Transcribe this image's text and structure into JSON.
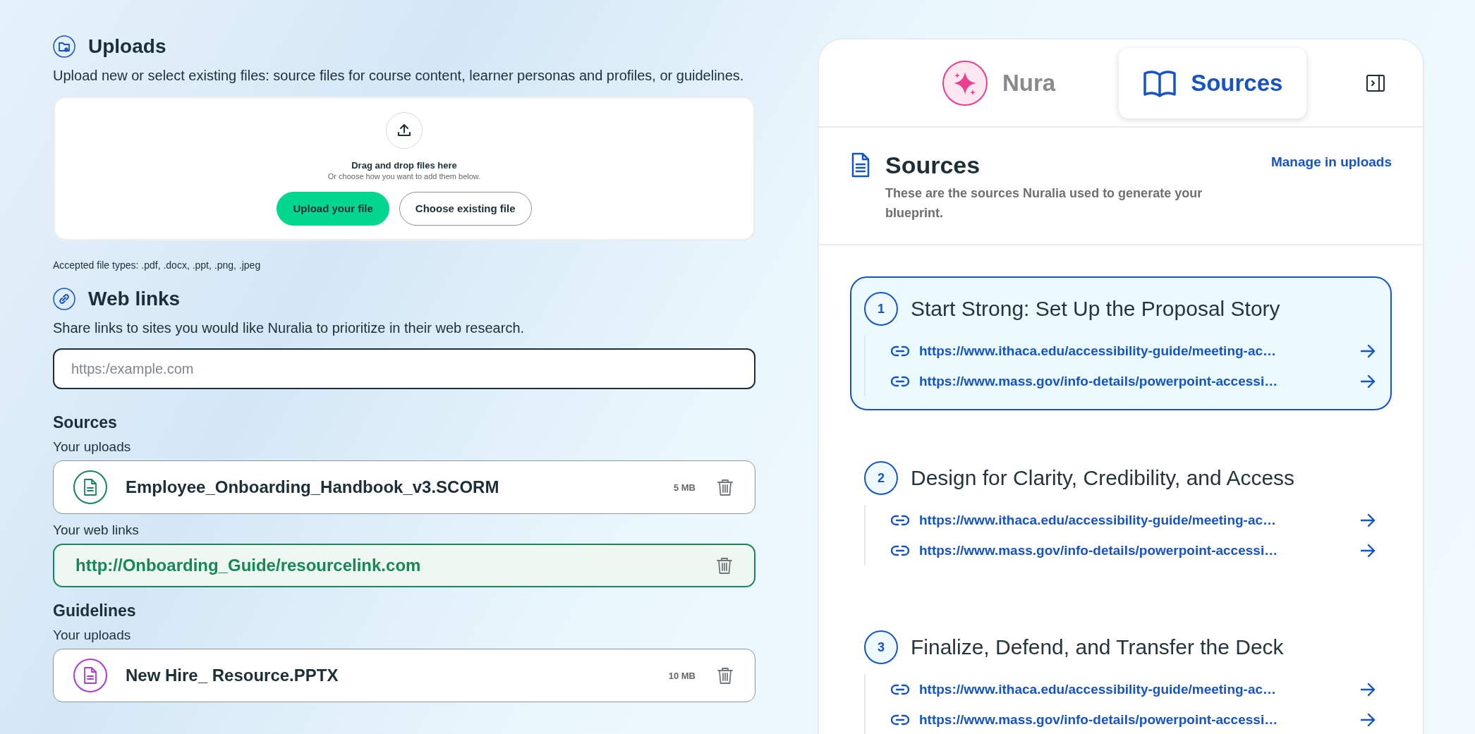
{
  "uploads": {
    "title": "Uploads",
    "description": "Upload new or select existing files: source files for course content, learner personas and profiles, or guidelines.",
    "dropzone": {
      "title": "Drag and drop files here",
      "subtitle": "Or choose how you want to add them below.",
      "buttons": [
        {
          "label": "Upload your file",
          "kind": "primary"
        },
        {
          "label": "Choose existing file",
          "kind": "secondary"
        }
      ]
    },
    "accepted": "Accepted file types: .pdf, .docx, .ppt, .png, .jpeg"
  },
  "web_links": {
    "title": "Web links",
    "description": "Share links to sites you would like Nuralia to prioritize in their web research.",
    "input": {
      "placeholder": "https:/example.com"
    }
  },
  "groups": [
    {
      "title": "Sources",
      "lists": [
        {
          "label": "Your uploads",
          "items": [
            {
              "kind": "file",
              "name": "Employee_Onboarding_Handbook_v3.SCORM",
              "size": "5 MB",
              "color": "#17865a"
            }
          ]
        },
        {
          "label": "Your web links",
          "items": [
            {
              "kind": "link",
              "name": "http://Onboarding_Guide/resourcelink.com"
            }
          ]
        }
      ]
    },
    {
      "title": "Guidelines",
      "lists": [
        {
          "label": "Your uploads",
          "items": [
            {
              "kind": "file",
              "name": "New Hire_ Resource.PPTX",
              "size": "10 MB",
              "color": "#b03ad4"
            }
          ]
        }
      ]
    }
  ],
  "panel": {
    "tabs": [
      {
        "label": "Nura",
        "kind": "assistant",
        "selected": false
      },
      {
        "label": "Sources",
        "kind": "book",
        "selected": true
      }
    ],
    "header": {
      "title": "Sources",
      "description": "These are the sources Nuralia used to generate your blueprint.",
      "link": "Manage in uploads"
    },
    "sections": [
      {
        "number": "1",
        "title": "Start Strong: Set Up the Proposal Story",
        "selected": true,
        "links": [
          "https://www.ithaca.edu/accessibility-guide/meeting-ac…",
          "https://www.mass.gov/info-details/powerpoint-accessi…"
        ]
      },
      {
        "number": "2",
        "title": "Design for Clarity, Credibility, and Access",
        "selected": false,
        "links": [
          "https://www.ithaca.edu/accessibility-guide/meeting-ac…",
          "https://www.mass.gov/info-details/powerpoint-accessi…"
        ]
      },
      {
        "number": "3",
        "title": "Finalize, Defend, and Transfer the Deck",
        "selected": false,
        "links": [
          "https://www.ithaca.edu/accessibility-guide/meeting-ac…",
          "https://www.mass.gov/info-details/powerpoint-accessi…"
        ]
      }
    ]
  }
}
